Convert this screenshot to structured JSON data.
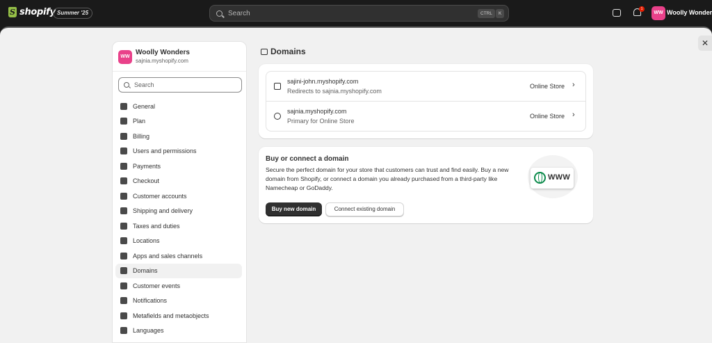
{
  "topbar": {
    "brand": "shopify",
    "edition_badge": "Summer '25",
    "search_placeholder": "Search",
    "shortcut_ctrl": "CTRL",
    "shortcut_k": "K",
    "notification_count": "1",
    "user_initials": "WW",
    "user_name": "Woolly Wonders"
  },
  "sidebar": {
    "store_initials": "WW",
    "store_name": "Woolly Wonders",
    "store_url": "sajnia.myshopify.com",
    "search_placeholder": "Search",
    "items": [
      {
        "label": "General",
        "icon": "store-icon"
      },
      {
        "label": "Plan",
        "icon": "plan-icon"
      },
      {
        "label": "Billing",
        "icon": "billing-icon"
      },
      {
        "label": "Users and permissions",
        "icon": "users-icon"
      },
      {
        "label": "Payments",
        "icon": "payments-icon"
      },
      {
        "label": "Checkout",
        "icon": "cart-icon"
      },
      {
        "label": "Customer accounts",
        "icon": "customer-icon"
      },
      {
        "label": "Shipping and delivery",
        "icon": "truck-icon"
      },
      {
        "label": "Taxes and duties",
        "icon": "tax-icon"
      },
      {
        "label": "Locations",
        "icon": "location-icon"
      },
      {
        "label": "Apps and sales channels",
        "icon": "apps-icon"
      },
      {
        "label": "Domains",
        "icon": "domains-icon",
        "active": true
      },
      {
        "label": "Customer events",
        "icon": "events-icon"
      },
      {
        "label": "Notifications",
        "icon": "bell-icon"
      },
      {
        "label": "Metafields and metaobjects",
        "icon": "metafields-icon"
      },
      {
        "label": "Languages",
        "icon": "language-icon"
      }
    ]
  },
  "main": {
    "title": "Domains",
    "domains": [
      {
        "name": "sajini-john.myshopify.com",
        "sub": "Redirects to sajnia.myshopify.com",
        "channel": "Online Store",
        "icon": "redirect-icon"
      },
      {
        "name": "sajnia.myshopify.com",
        "sub": "Primary for Online Store",
        "channel": "Online Store",
        "icon": "globe-icon"
      }
    ],
    "buy": {
      "title": "Buy or connect a domain",
      "description": "Secure the perfect domain for your store that customers can trust and find easily. Buy a new domain from Shopify, or connect a domain you already purchased from a third-party like Namecheap or GoDaddy.",
      "primary_label": "Buy new domain",
      "secondary_label": "Connect existing domain",
      "illustration_text": "WWW"
    }
  },
  "colors": {
    "topbar_bg": "#1a1a1a",
    "avatar": "#e9418a",
    "globe": "#0a8a4a",
    "primary_button": "#303030"
  }
}
